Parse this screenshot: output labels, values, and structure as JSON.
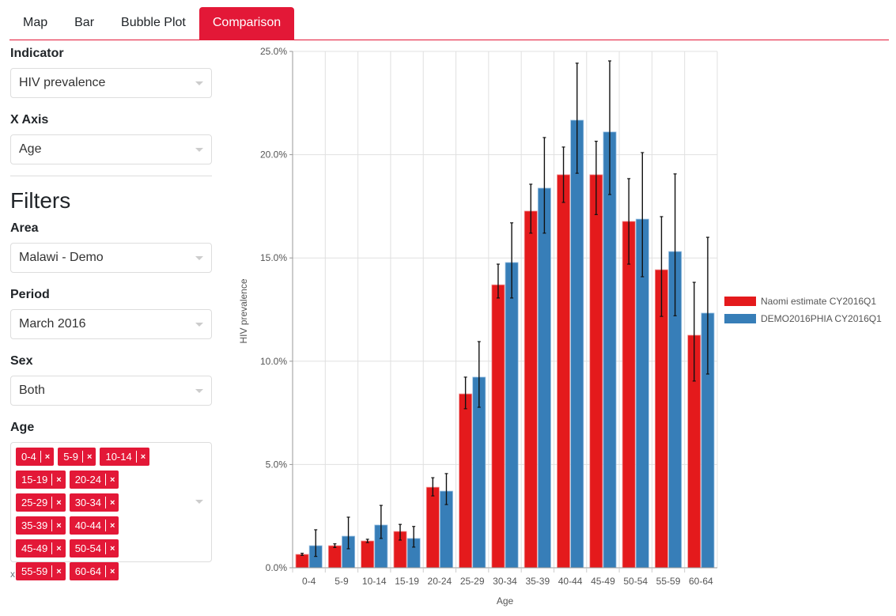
{
  "tabs": [
    {
      "label": "Map",
      "active": false
    },
    {
      "label": "Bar",
      "active": false
    },
    {
      "label": "Bubble Plot",
      "active": false
    },
    {
      "label": "Comparison",
      "active": true
    }
  ],
  "controls": {
    "indicator_label": "Indicator",
    "indicator_value": "HIV prevalence",
    "xaxis_label": "X Axis",
    "xaxis_value": "Age",
    "filters_heading": "Filters",
    "area_label": "Area",
    "area_value": "Malawi - Demo",
    "period_label": "Period",
    "period_value": "March 2016",
    "sex_label": "Sex",
    "sex_value": "Both",
    "age_label": "Age",
    "age_chips": [
      "0-4",
      "5-9",
      "10-14",
      "15-19",
      "20-24",
      "25-29",
      "30-34",
      "35-39",
      "40-44",
      "45-49",
      "50-54",
      "55-59",
      "60-64"
    ],
    "age_help": "x axis",
    "chip_remove_glyph": "×"
  },
  "colors": {
    "accent": "#e31837",
    "series1": "#e41a1c",
    "series2": "#377eb8"
  },
  "chart_data": {
    "type": "bar",
    "xlabel": "Age",
    "ylabel": "HIV prevalence",
    "ylim": [
      0,
      25
    ],
    "yticks": [
      "0.0%",
      "5.0%",
      "10.0%",
      "15.0%",
      "20.0%",
      "25.0%"
    ],
    "grid": true,
    "legend_position": "right",
    "categories": [
      "0-4",
      "5-9",
      "10-14",
      "15-19",
      "20-24",
      "25-29",
      "30-34",
      "35-39",
      "40-44",
      "45-49",
      "50-54",
      "55-59",
      "60-64"
    ],
    "series": [
      {
        "name": "Naomi estimate CY2016Q1",
        "color": "#e41a1c",
        "values": [
          0.65,
          1.07,
          1.3,
          1.76,
          3.9,
          8.42,
          13.7,
          17.27,
          19.03,
          19.03,
          16.77,
          14.43,
          11.26
        ],
        "lower": [
          0.6,
          0.98,
          1.22,
          1.34,
          3.48,
          7.7,
          13.06,
          16.2,
          17.69,
          17.1,
          14.7,
          12.17,
          9.04
        ],
        "upper": [
          0.7,
          1.16,
          1.38,
          2.1,
          4.36,
          9.23,
          14.7,
          18.57,
          20.37,
          20.65,
          18.84,
          17.0,
          13.82
        ]
      },
      {
        "name": "DEMO2016PHIA CY2016Q1",
        "color": "#377eb8",
        "values": [
          1.07,
          1.53,
          2.07,
          1.42,
          3.71,
          9.23,
          14.78,
          18.38,
          21.67,
          21.1,
          16.88,
          15.31,
          12.33
        ],
        "lower": [
          0.55,
          0.92,
          1.42,
          1.0,
          3.06,
          7.77,
          13.06,
          16.2,
          19.1,
          18.07,
          14.09,
          12.2,
          9.38
        ],
        "upper": [
          1.84,
          2.45,
          3.02,
          2.0,
          4.56,
          10.95,
          16.7,
          20.83,
          24.43,
          24.54,
          20.1,
          19.07,
          16.0
        ]
      }
    ]
  }
}
